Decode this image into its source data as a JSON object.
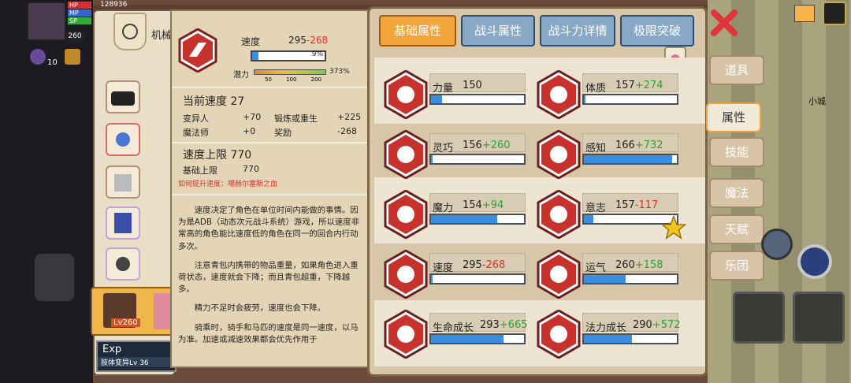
{
  "hud": {
    "hp_label": "HP",
    "mp_label": "MP",
    "sp_label": "SP",
    "level_badge": "260",
    "hp_value": "128936",
    "gold": "10"
  },
  "left_panel": {
    "title": "机械",
    "char_level": "Lv260",
    "exp_label": "Exp",
    "subtitle": "肢体变异Lv 36"
  },
  "detail": {
    "stat_name": "速度",
    "stat_base": "295",
    "stat_penalty": "-268",
    "bar_percent": "9%",
    "bar_fraction": 0.09,
    "potential_label": "潜力",
    "potential_ticks": [
      "50",
      "100",
      "200"
    ],
    "potential_percent": "373%",
    "current_label": "当前速度 27",
    "rows": [
      {
        "a": "变异人",
        "b": "+70",
        "c": "锻炼或重生",
        "d": "+225"
      },
      {
        "a": "魔法师",
        "b": "+0",
        "c": "奖励",
        "d": "-268"
      }
    ],
    "cap_label": "速度上限 770",
    "cap_base_label": "基础上限",
    "cap_base_value": "770",
    "tip": "如何提升速度：噶赫尔塞斯之血",
    "paragraphs": [
      "速度决定了角色在单位时间内能做的事情。因为是ADB（动态次元战斗系统）游戏，所以速度非常高的角色能比速度低的角色在同一的回合内行动多次。",
      "注意青包内携带的物品重量，如果角色进入重荷状态，速度就会下降；而且青包超重，下降越多。",
      "精力不足时会疲劳，速度也会下降。",
      "骑乘时，骑手和马匹的速度是同一速度，以马为准。加速或减速效果都会优先作用于"
    ]
  },
  "tabs": [
    "基础属性",
    "战斗属性",
    "战斗力详情",
    "极限突破"
  ],
  "side_tabs": [
    "道具",
    "属性",
    "技能",
    "魔法",
    "天赋",
    "乐团"
  ],
  "map_label": "小城",
  "stats": [
    {
      "name": "力量",
      "base": "150",
      "mod": "",
      "sign": "",
      "fill": 0.12,
      "icon": "arm-icon"
    },
    {
      "name": "体质",
      "base": "157",
      "mod": "+274",
      "sign": "plus",
      "fill": 0.02,
      "icon": "muscle-body-icon"
    },
    {
      "name": "灵巧",
      "base": "156",
      "mod": "+260",
      "sign": "plus",
      "fill": 0.02,
      "icon": "running-icon"
    },
    {
      "name": "感知",
      "base": "166",
      "mod": "+732",
      "sign": "plus",
      "fill": 0.95,
      "icon": "eye-icon"
    },
    {
      "name": "魔力",
      "base": "154",
      "mod": "+94",
      "sign": "plus",
      "fill": 0.71,
      "icon": "spiral-icon"
    },
    {
      "name": "意志",
      "base": "157",
      "mod": "-117",
      "sign": "minus",
      "fill": 0.1,
      "icon": "head-bolt-icon"
    },
    {
      "name": "速度",
      "base": "295",
      "mod": "-268",
      "sign": "minus",
      "fill": 0.02,
      "icon": "speed-icon"
    },
    {
      "name": "运气",
      "base": "260",
      "mod": "+158",
      "sign": "plus",
      "fill": 0.45,
      "icon": "clover-icon"
    },
    {
      "name": "生命成长",
      "base": "293",
      "mod": "+665",
      "sign": "plus",
      "fill": 0.78,
      "icon": "heart-icon"
    },
    {
      "name": "法力成长",
      "base": "290",
      "mod": "+572",
      "sign": "plus",
      "fill": 0.52,
      "icon": "figure-icon"
    }
  ],
  "colors": {
    "accent": "#f3a43b",
    "tab": "#88a9c6",
    "bar": "#3a8fe0",
    "hex": "#c8322d",
    "plus": "#2fa32f",
    "minus": "#d6332e"
  }
}
